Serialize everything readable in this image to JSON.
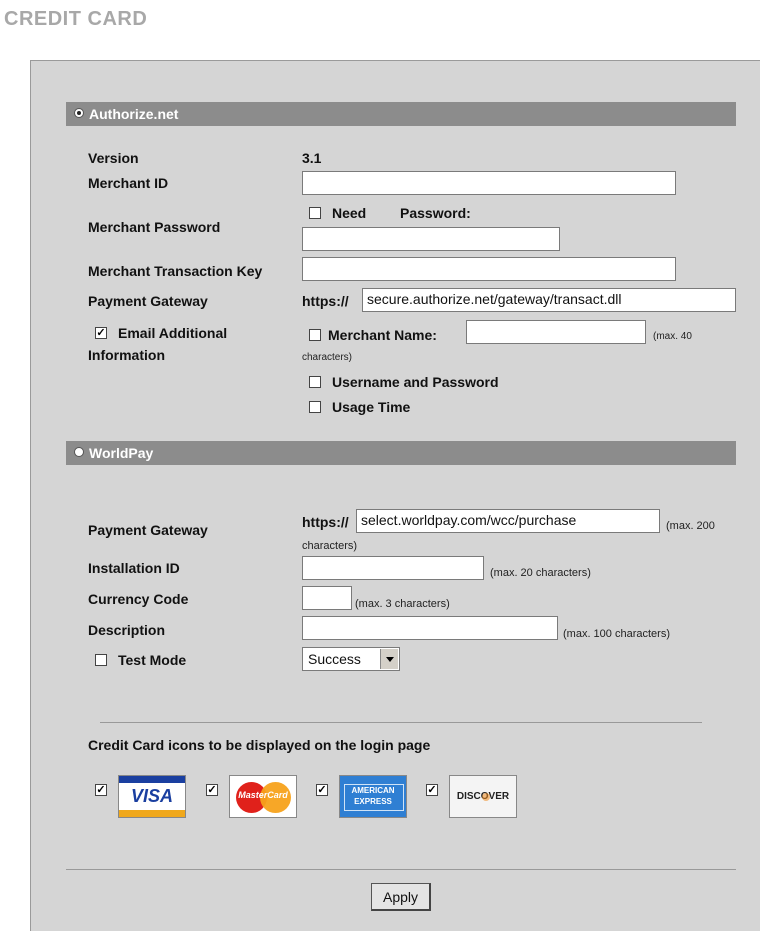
{
  "page_title": "CREDIT CARD",
  "authorize": {
    "section_label": "Authorize.net",
    "version_label": "Version",
    "version_value": "3.1",
    "merchant_id_label": "Merchant ID",
    "merchant_id_value": "",
    "merchant_password_label": "Merchant Password",
    "need_label": "Need",
    "password_label": "Password:",
    "merchant_password_value": "",
    "transaction_key_label": "Merchant Transaction Key",
    "transaction_key_value": "",
    "gateway_label": "Payment Gateway",
    "gateway_prefix": "https://",
    "gateway_value": "secure.authorize.net/gateway/transact.dll",
    "email_info_label_1": "Email Additional",
    "email_info_label_2": "Information",
    "email_info_checked": true,
    "merchant_name_label": "Merchant Name:",
    "merchant_name_value": "",
    "merchant_name_hint_1": "(max. 40",
    "merchant_name_hint_2": "characters)",
    "username_password_label": "Username and Password",
    "usage_time_label": "Usage Time"
  },
  "worldpay": {
    "section_label": "WorldPay",
    "gateway_label": "Payment Gateway",
    "gateway_prefix": "https://",
    "gateway_value": "select.worldpay.com/wcc/purchase",
    "gateway_hint_1": "(max. 200",
    "gateway_hint_2": "characters)",
    "installation_label": "Installation ID",
    "installation_value": "",
    "installation_hint": "(max. 20 characters)",
    "currency_label": "Currency Code",
    "currency_value": "",
    "currency_hint": "(max. 3 characters)",
    "description_label": "Description",
    "description_value": "",
    "description_hint": "(max. 100 characters)",
    "test_mode_label": "Test Mode",
    "test_mode_select": "Success"
  },
  "cards": {
    "heading": "Credit Card icons to be displayed on the login page",
    "visa": "VISA",
    "mastercard": "MasterCard",
    "amex_1": "AMERICAN",
    "amex_2": "EXPRESS",
    "discover": "DISCOVER"
  },
  "apply_label": "Apply"
}
